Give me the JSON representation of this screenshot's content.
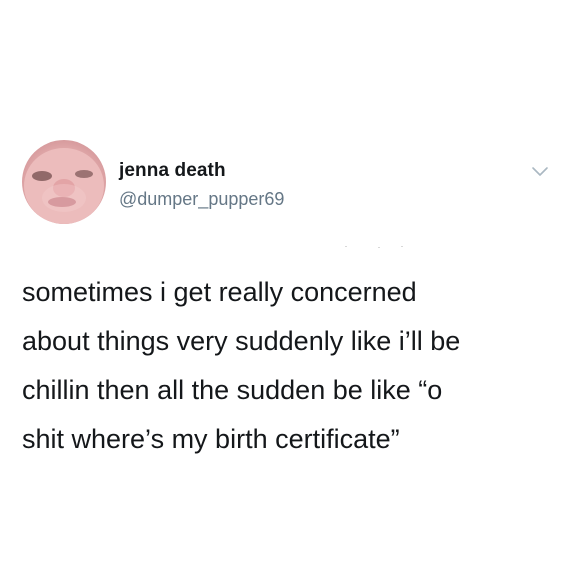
{
  "tweet": {
    "author_name": "jenna death",
    "author_handle": "@dumper_pupper69",
    "text_lines": [
      "sometimes i get really concerned",
      "about things very suddenly like i’ll be",
      "chillin then all the sudden be like “o",
      "shit where’s my birth certificate”"
    ],
    "avatar_icon": "avatar-photo",
    "menu_icon": "chevron-down-icon"
  },
  "colors": {
    "background": "#ffffff",
    "name": "#14171a",
    "handle": "#657786",
    "text": "#14171a",
    "chevron": "#aab8c2"
  }
}
